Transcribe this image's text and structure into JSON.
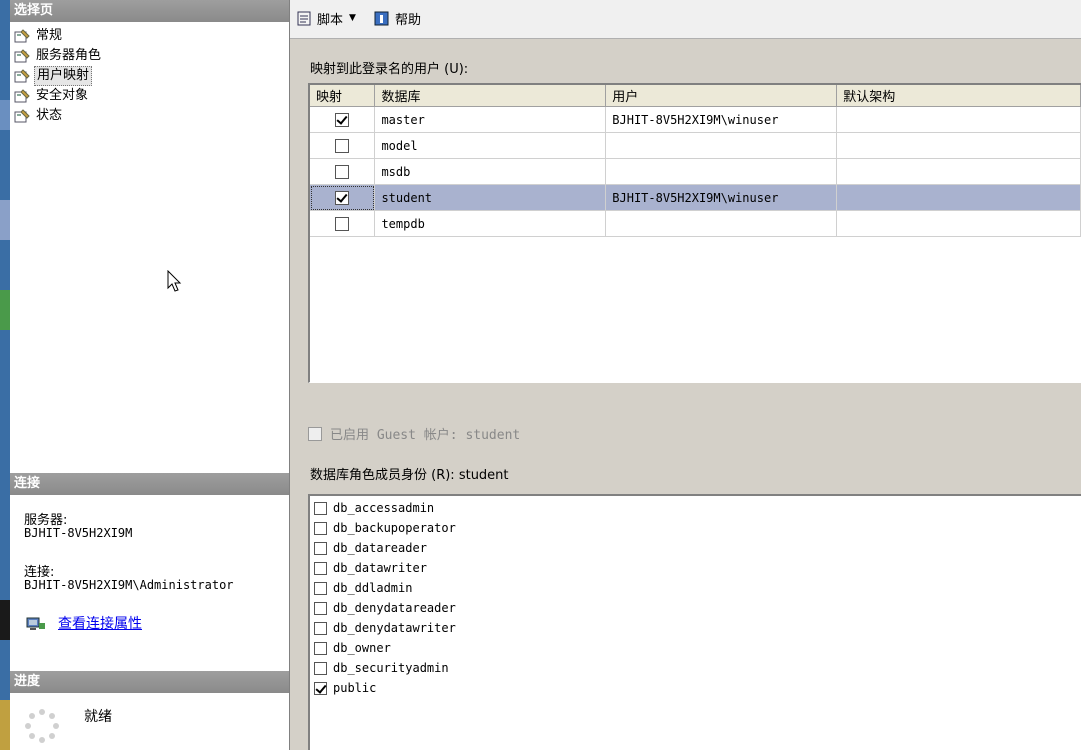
{
  "left_panel": {
    "select_page_header": "选择页",
    "pages": [
      {
        "label": "常规",
        "icon": "page-wrench-icon"
      },
      {
        "label": "服务器角色",
        "icon": "page-wrench-icon"
      },
      {
        "label": "用户映射",
        "icon": "page-wrench-icon"
      },
      {
        "label": "安全对象",
        "icon": "page-wrench-icon"
      },
      {
        "label": "状态",
        "icon": "page-wrench-icon"
      }
    ],
    "selected_page": "用户映射",
    "connection_header": "连接",
    "server_label": "服务器:",
    "server_value": "BJHIT-8V5H2XI9M",
    "connection_label": "连接:",
    "connection_value": "BJHIT-8V5H2XI9M\\Administrator",
    "view_properties_link": "查看连接属性",
    "progress_header": "进度",
    "progress_status": "就绪"
  },
  "toolbar": {
    "script_label": "脚本",
    "help_label": "帮助"
  },
  "mapping": {
    "title": "映射到此登录名的用户 (U):",
    "columns": [
      "映射",
      "数据库",
      "用户",
      "默认架构"
    ],
    "rows": [
      {
        "mapped": true,
        "database": "master",
        "user": "BJHIT-8V5H2XI9M\\winuser",
        "schema": ""
      },
      {
        "mapped": false,
        "database": "model",
        "user": "",
        "schema": ""
      },
      {
        "mapped": false,
        "database": "msdb",
        "user": "",
        "schema": ""
      },
      {
        "mapped": true,
        "database": "student",
        "user": "BJHIT-8V5H2XI9M\\winuser",
        "schema": "",
        "selected": true
      },
      {
        "mapped": false,
        "database": "tempdb",
        "user": "",
        "schema": ""
      }
    ]
  },
  "guest": {
    "label": "已启用 Guest 帐户: student",
    "checked": false,
    "enabled": false
  },
  "roles": {
    "title": "数据库角色成员身份 (R): student",
    "items": [
      {
        "name": "db_accessadmin",
        "checked": false
      },
      {
        "name": "db_backupoperator",
        "checked": false
      },
      {
        "name": "db_datareader",
        "checked": false
      },
      {
        "name": "db_datawriter",
        "checked": false
      },
      {
        "name": "db_ddladmin",
        "checked": false
      },
      {
        "name": "db_denydatareader",
        "checked": false
      },
      {
        "name": "db_denydatawriter",
        "checked": false
      },
      {
        "name": "db_owner",
        "checked": false
      },
      {
        "name": "db_securityadmin",
        "checked": false
      },
      {
        "name": "public",
        "checked": true
      }
    ]
  },
  "colors": {
    "header_gray": "#8a8a8a",
    "selected_row": "#a9b2cf",
    "link": "#0000ee",
    "panel_bg": "#d4d0c8"
  }
}
